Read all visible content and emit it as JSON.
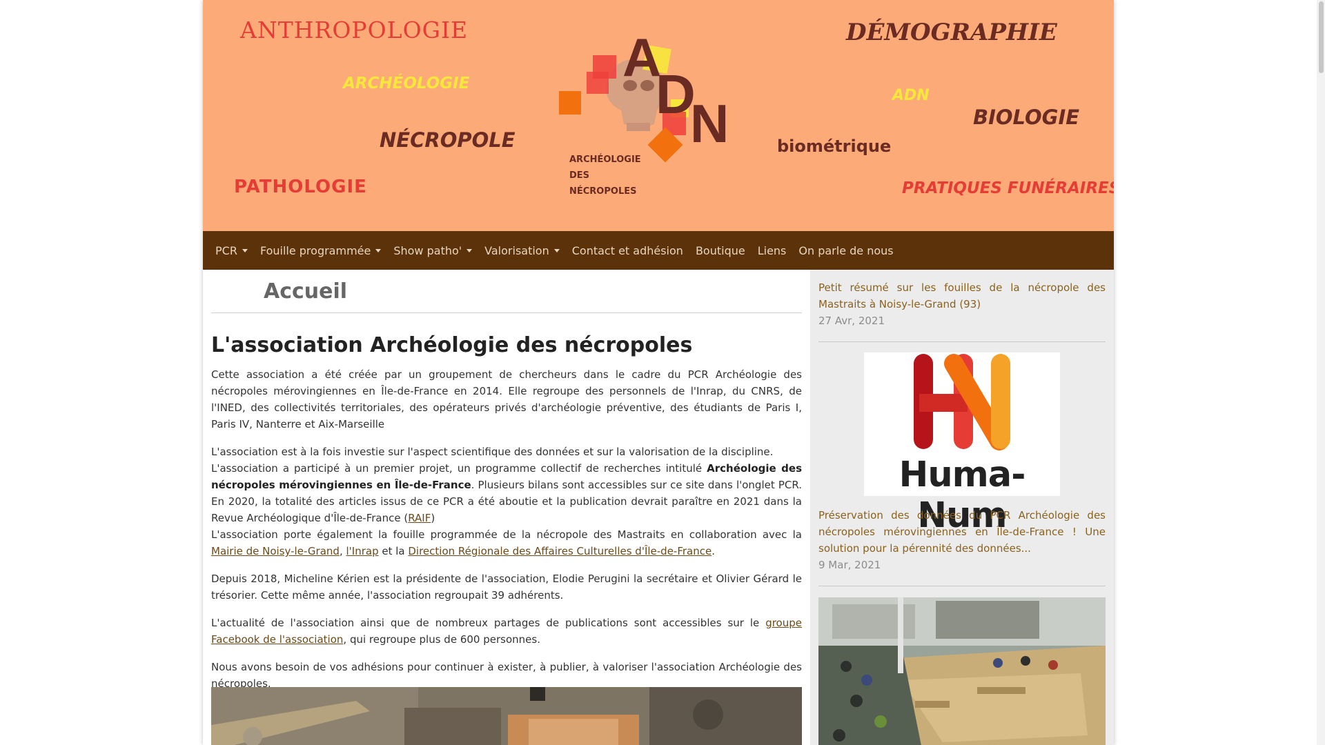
{
  "banner": {
    "words": {
      "anthropologie": "ANTHROPOLOGIE",
      "archeologie": "ARCHÉOLOGIE",
      "necropole": "NÉCROPOLE",
      "pathologie": "PATHOLOGIE",
      "demographie": "DÉMOGRAPHIE",
      "adn": "ADN",
      "biologie": "BIOLOGIE",
      "biometrique": "biométrique",
      "pratiques": "PRATIQUES FUNÉRAIRES"
    },
    "logo": {
      "letters": [
        "A",
        "D",
        "N"
      ],
      "caption_line1": "ARCHÉOLOGIE",
      "caption_line2": "DES",
      "caption_line3": "NÉCROPOLES"
    }
  },
  "nav": {
    "items": [
      {
        "label": "PCR",
        "dropdown": true
      },
      {
        "label": "Fouille programmée",
        "dropdown": true
      },
      {
        "label": "Show patho'",
        "dropdown": true
      },
      {
        "label": "Valorisation",
        "dropdown": true
      },
      {
        "label": "Contact et adhésion",
        "dropdown": false
      },
      {
        "label": "Boutique",
        "dropdown": false
      },
      {
        "label": "Liens",
        "dropdown": false
      },
      {
        "label": "On parle de nous",
        "dropdown": false
      }
    ]
  },
  "main": {
    "page_title": "Accueil",
    "heading": "L'association Archéologie des nécropoles",
    "p1": "Cette association a été créée par un groupement de chercheurs dans le cadre du PCR Archéologie des nécropoles mérovingiennes en Île-de-France en 2014. Elle regroupe des personnels de l'Inrap, du CNRS, de l'INED, des collectivités territoriales, des opérateurs privés d'archéologie préventive, des étudiants de Paris I, Paris IV, Nanterre et Aix-Marseille",
    "p2_line1": "L'association est à la fois investie sur l'aspect scientifique des données et sur la valorisation de la discipline.",
    "p2_a": "L'association a participé à un premier projet, un programme collectif de recherches intitulé ",
    "p2_bold": "Archéologie des nécropoles mérovingiennes en Île-de-France",
    "p2_b": ". Plusieurs bilans sont accessibles sur ce site dans l'onglet PCR. En 2020, la totalité des articles issus de ce PCR a été aboutie et la publication devrait paraître en 2021 dans la Revue Archéologique d'Île-de-France (",
    "p2_raif": "RAIF",
    "p2_c": ")",
    "p2_d": "L'association porte également la fouille programmée de la nécropole des Mastraits en collaboration avec la ",
    "p2_link_mairie": "Mairie de Noisy-le-Grand",
    "p2_sep1": ", ",
    "p2_link_inrap": "l'Inrap",
    "p2_sep2": " et la ",
    "p2_link_drac": "Direction Régionale des Affaires Culturelles d'Île-de-France",
    "p2_end": ".",
    "p3": "Depuis 2018, Micheline Kérien est la présidente de l'association, Elodie Perugini la secrétaire et Olivier Gérard le trésorier. Cette même année, l'association regroupait 39 adhérents.",
    "p4_a": "L'actualité de l'association ainsi que de nombreux partages de publications sont accessibles sur le ",
    "p4_link": "groupe Facebook de l'association",
    "p4_b": ", qui regroupe plus de 600 personnes.",
    "p5": "Nous avons besoin de vos adhésions pour continuer à exister, à publier, à valoriser l'association Archéologie des nécropoles."
  },
  "sidebar": {
    "post1_title": "Petit résumé sur les fouilles de la nécropole des Mastraits à Noisy-le-Grand (93)",
    "post1_date": "27 Avr, 2021",
    "huma_logo_text": "Huma-Num",
    "post2_title": "Préservation des données du PCR Archéologie des nécropoles mérovingiennes en Île-de-France ! Une solution pour la pérennité des données...",
    "post2_date": "9 Mar, 2021"
  },
  "colors": {
    "banner_bg": "#fbaa78",
    "nav_bg": "#5c320b",
    "nav_text": "#e9d6bf",
    "link": "#8a6220"
  }
}
